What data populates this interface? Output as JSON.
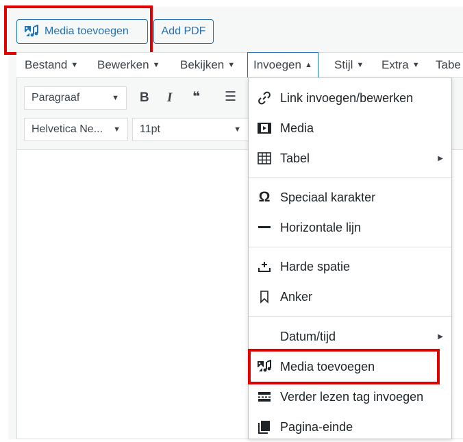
{
  "top_buttons": {
    "media_label": "Media toevoegen",
    "pdf_label": "Add PDF"
  },
  "menubar": [
    {
      "label": "Bestand",
      "caret": "▼"
    },
    {
      "label": "Bewerken",
      "caret": "▼"
    },
    {
      "label": "Bekijken",
      "caret": "▼"
    },
    {
      "label": "Invoegen",
      "caret": "▲"
    },
    {
      "label": "Stijl",
      "caret": "▼"
    },
    {
      "label": "Extra",
      "caret": "▼"
    },
    {
      "label": "Tabe",
      "caret": ""
    }
  ],
  "toolbar": {
    "format_select": "Paragraaf",
    "font_select": "Helvetica Ne...",
    "size_select": "11pt",
    "bold": "B",
    "italic": "I",
    "quote": "❝",
    "list": "☰"
  },
  "dropdown": {
    "items": [
      {
        "label": "Link invoegen/bewerken",
        "icon": "link-icon"
      },
      {
        "label": "Media",
        "icon": "video-icon"
      },
      {
        "label": "Tabel",
        "icon": "table-icon",
        "submenu": true
      },
      {
        "label": "Speciaal karakter",
        "icon": "omega-icon"
      },
      {
        "label": "Horizontale lijn",
        "icon": "horizontal-line-icon"
      },
      {
        "label": "Harde spatie",
        "icon": "nonbreaking-space-icon"
      },
      {
        "label": "Anker",
        "icon": "bookmark-icon"
      },
      {
        "label": "Datum/tijd",
        "icon": "",
        "submenu": true
      },
      {
        "label": "Media toevoegen",
        "icon": "add-media-icon"
      },
      {
        "label": "Verder lezen tag invoegen",
        "icon": "read-more-icon"
      },
      {
        "label": "Pagina-einde",
        "icon": "page-break-icon"
      }
    ],
    "glyphs": {
      "omega": "Ω",
      "submenu_arrow": "▶",
      "caret_down": "▼"
    }
  },
  "colors": {
    "accent": "#2271b1",
    "highlight": "#e00000",
    "background": "#f6f7f7"
  }
}
